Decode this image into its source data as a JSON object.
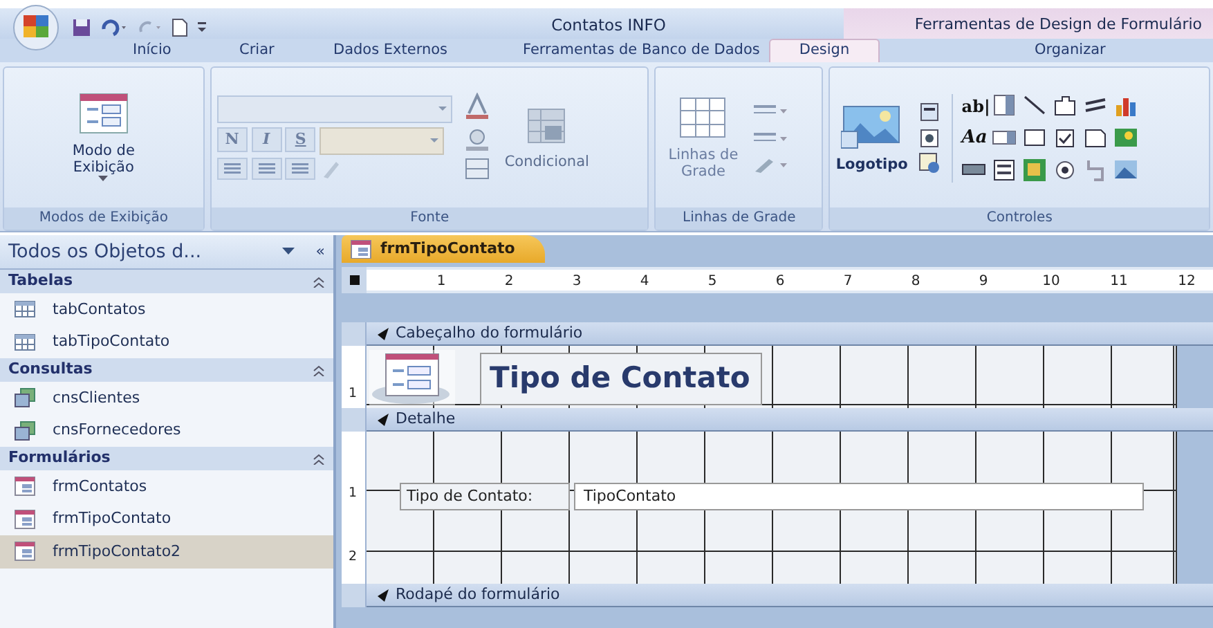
{
  "window": {
    "title": "Contatos INFO",
    "context_title": "Ferramentas de Design de Formulário"
  },
  "ribbon_tabs": [
    {
      "label": "Início",
      "selected": false
    },
    {
      "label": "Criar",
      "selected": false
    },
    {
      "label": "Dados Externos",
      "selected": false
    },
    {
      "label": "Ferramentas de Banco de Dados",
      "selected": false
    },
    {
      "label": "Design",
      "selected": true
    },
    {
      "label": "Organizar",
      "selected": false
    }
  ],
  "ribbon": {
    "views": {
      "label": "Modos de Exibição",
      "button": "Modo de Exibição"
    },
    "font": {
      "label": "Fonte",
      "format_buttons": [
        "N",
        "I",
        "S"
      ],
      "conditional": "Condicional"
    },
    "gridlines": {
      "label": "Linhas de Grade",
      "button": "Linhas de Grade"
    },
    "controls": {
      "label": "Controles",
      "logo": "Logotipo",
      "text_tools": [
        "ab|",
        "Aa"
      ]
    }
  },
  "navigation": {
    "title": "Todos os Objetos d...",
    "collapse": "«",
    "groups": [
      {
        "label": "Tabelas",
        "expanded": true,
        "items": [
          {
            "label": "tabContatos",
            "kind": "table",
            "selected": false
          },
          {
            "label": "tabTipoContato",
            "kind": "table",
            "selected": false
          }
        ]
      },
      {
        "label": "Consultas",
        "expanded": true,
        "items": [
          {
            "label": "cnsClientes",
            "kind": "query",
            "selected": false
          },
          {
            "label": "cnsFornecedores",
            "kind": "query",
            "selected": false
          }
        ]
      },
      {
        "label": "Formulários",
        "expanded": true,
        "items": [
          {
            "label": "frmContatos",
            "kind": "form",
            "selected": false
          },
          {
            "label": "frmTipoContato",
            "kind": "form",
            "selected": false
          },
          {
            "label": "frmTipoContato2",
            "kind": "form",
            "selected": true
          }
        ]
      }
    ]
  },
  "document": {
    "tab": "frmTipoContato",
    "ruler": [
      "1",
      "2",
      "3",
      "4",
      "5",
      "6",
      "7",
      "8",
      "9",
      "10",
      "11",
      "12"
    ],
    "sections": [
      {
        "label": "Cabeçalho do formulário",
        "kind": "header",
        "ruler": [
          "1"
        ],
        "controls": [
          {
            "kind": "logo"
          },
          {
            "kind": "title",
            "text": "Tipo de Contato"
          }
        ]
      },
      {
        "label": "Detalhe",
        "kind": "detail",
        "ruler": [
          "1",
          "2"
        ],
        "controls": [
          {
            "kind": "label",
            "text": "Tipo de Contato:"
          },
          {
            "kind": "textbox",
            "text": "TipoContato"
          }
        ]
      },
      {
        "label": "Rodapé do formulário",
        "kind": "footer"
      }
    ]
  }
}
